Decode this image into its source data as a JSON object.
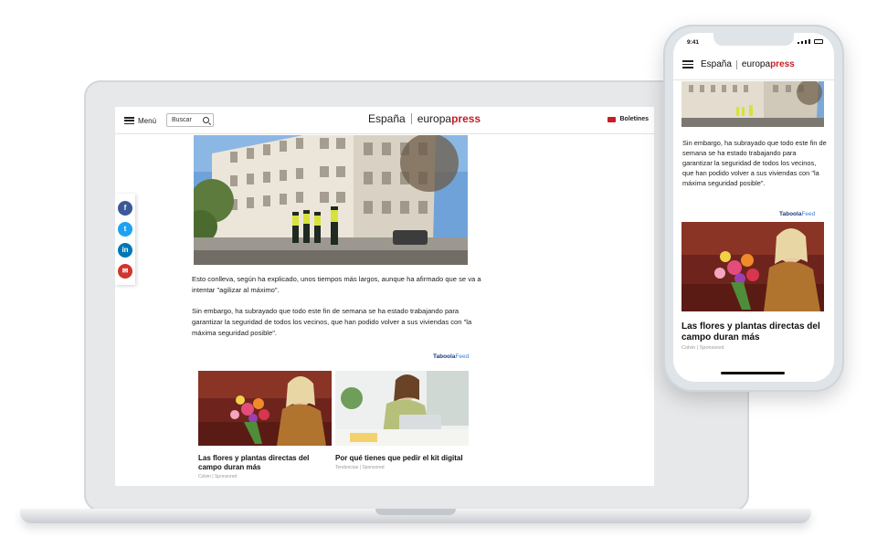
{
  "laptop": {
    "header": {
      "menu_label": "Menú",
      "search_label": "Buscar",
      "logo_es": "España",
      "logo_europa": "europa",
      "logo_press": "press",
      "newsletter_label": "Boletines"
    },
    "share": {
      "facebook": "f",
      "twitter": "t",
      "linkedin": "in",
      "email": "✉"
    },
    "article": {
      "para1": "Esto conlleva, según ha explicado, unos tiempos más largos, aunque ha afirmado que se va a intentar \"agilizar al máximo\".",
      "para2": "Sin embargo, ha subrayado que todo este fin de semana se ha estado trabajando para garantizar la seguridad de todos los vecinos, que han podido volver a sus viviendas con \"la máxima seguridad posible\"."
    },
    "taboola": {
      "brand": "Taboola",
      "feed": "Feed"
    },
    "cards": [
      {
        "title": "Las flores y plantas directas del campo duran más",
        "source": "Colvin | Sponsored"
      },
      {
        "title": "Por qué tienes que pedir el kit digital",
        "source": "Tendencias | Sponsored"
      }
    ]
  },
  "phone": {
    "time": "9:41",
    "logo_es": "España",
    "logo_europa": "europa",
    "logo_press": "press",
    "article_text": "Sin embargo, ha subrayado que todo este fin de semana se ha estado trabajando para garantizar la seguridad de todos los vecinos, que han podido volver a sus viviendas con \"la máxima seguridad posible\".",
    "taboola": {
      "brand": "Taboola",
      "feed": "Feed"
    },
    "card": {
      "title": "Las flores y plantas directas del campo duran más",
      "source": "Colvin | Sponsored"
    }
  },
  "colors": {
    "brand_red": "#c81d25",
    "facebook": "#3b5998",
    "twitter": "#1da1f2",
    "linkedin": "#0077b5",
    "email": "#d0352e",
    "taboola_blue": "#1b3c78"
  }
}
